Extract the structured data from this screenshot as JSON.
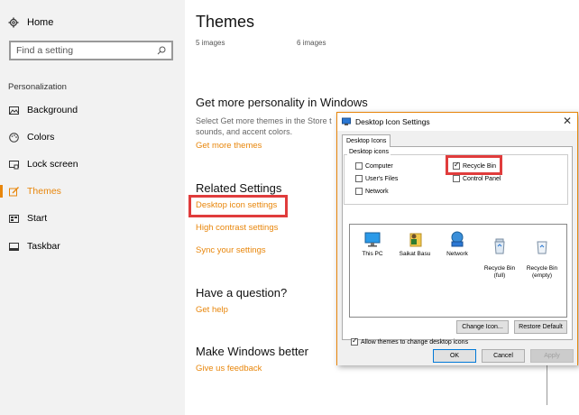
{
  "sidebar": {
    "home_label": "Home",
    "search_placeholder": "Find a setting",
    "section_label": "Personalization",
    "items": [
      {
        "label": "Background",
        "icon": "picture-icon"
      },
      {
        "label": "Colors",
        "icon": "palette-icon"
      },
      {
        "label": "Lock screen",
        "icon": "lock-screen-icon"
      },
      {
        "label": "Themes",
        "icon": "brush-icon",
        "active": true
      },
      {
        "label": "Start",
        "icon": "start-icon"
      },
      {
        "label": "Taskbar",
        "icon": "taskbar-icon"
      }
    ]
  },
  "main": {
    "title": "Themes",
    "image_counts": [
      "5 images",
      "6 images"
    ],
    "personality": {
      "heading": "Get more personality in Windows",
      "description": "Select Get more themes in the Store t sounds, and accent colors.",
      "link": "Get more themes"
    },
    "related": {
      "heading": "Related Settings",
      "links": [
        "Desktop icon settings",
        "High contrast settings",
        "Sync your settings"
      ]
    },
    "question": {
      "heading": "Have a question?",
      "link": "Get help"
    },
    "better": {
      "heading": "Make Windows better",
      "link": "Give us feedback"
    }
  },
  "dialog": {
    "title": "Desktop Icon Settings",
    "tab": "Desktop Icons",
    "group_label": "Desktop icons",
    "checkboxes": [
      {
        "label": "Computer",
        "checked": false
      },
      {
        "label": "Recycle Bin",
        "checked": true
      },
      {
        "label": "User's Files",
        "checked": false
      },
      {
        "label": "Control Panel",
        "checked": false
      },
      {
        "label": "Network",
        "checked": false
      }
    ],
    "icons": [
      {
        "label": "This PC",
        "icon": "monitor-icon"
      },
      {
        "label": "Saikat Basu",
        "icon": "user-folder-icon"
      },
      {
        "label": "Network",
        "icon": "network-icon"
      },
      {
        "label": "Recycle Bin\n(full)",
        "icon": "recycle-bin-full-icon"
      },
      {
        "label": "Recycle Bin\n(empty)",
        "icon": "recycle-bin-empty-icon"
      }
    ],
    "change_icon": "Change Icon...",
    "restore_default": "Restore Default",
    "allow_themes": "Allow themes to change desktop icons",
    "ok": "OK",
    "cancel": "Cancel",
    "apply": "Apply"
  },
  "colors": {
    "accent": "#e8860b",
    "highlight": "#e03c3c"
  }
}
